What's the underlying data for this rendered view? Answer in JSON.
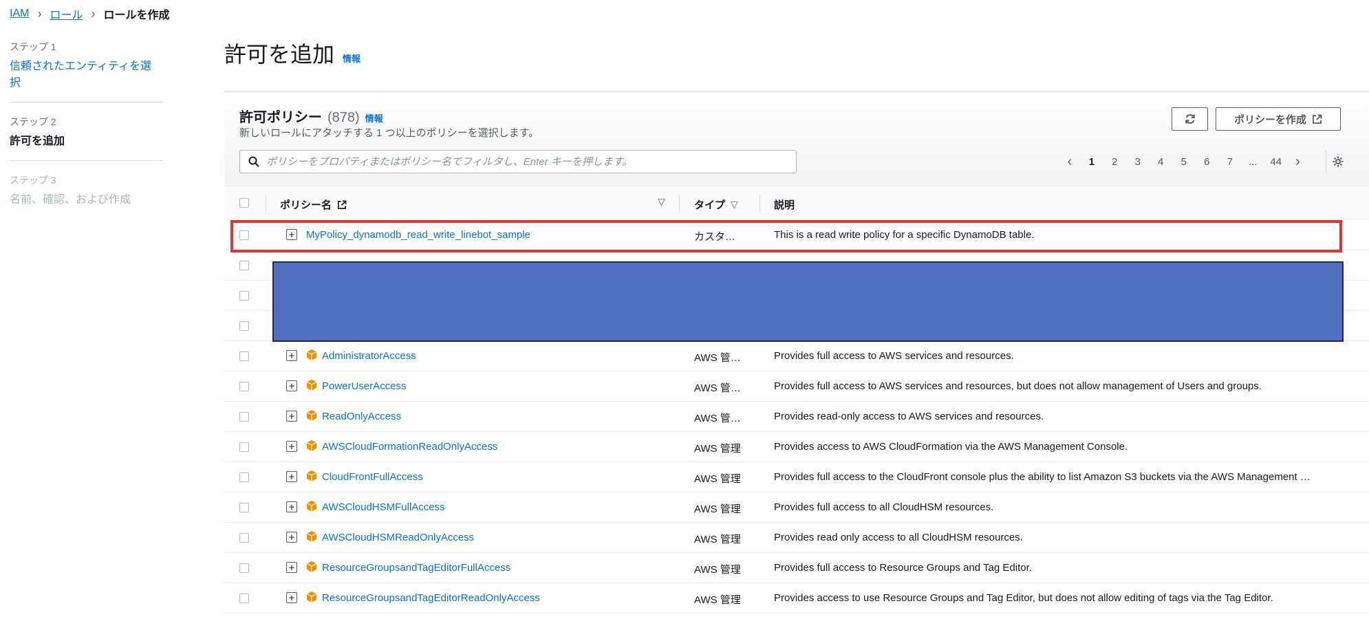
{
  "breadcrumb": {
    "items": [
      "IAM",
      "ロール"
    ],
    "current": "ロールを作成"
  },
  "steps": [
    {
      "label": "ステップ 1",
      "title": "信頼されたエンティティを選択",
      "state": "link"
    },
    {
      "label": "ステップ 2",
      "title": "許可を追加",
      "state": "active"
    },
    {
      "label": "ステップ 3",
      "title": "名前、確認、および作成",
      "state": "disabled"
    }
  ],
  "page": {
    "title": "許可を追加",
    "info": "情報"
  },
  "panel": {
    "title": "許可ポリシー",
    "count": "(878)",
    "info": "情報",
    "description": "新しいロールにアタッチする 1 つ以上のポリシーを選択します。",
    "create_button": "ポリシーを作成",
    "refresh_icon": "refresh-icon",
    "search_placeholder": "ポリシーをプロパティまたはポリシー名でフィルタし、Enter キーを押します。"
  },
  "pagination": {
    "pages": [
      "1",
      "2",
      "3",
      "4",
      "5",
      "6",
      "7",
      "...",
      "44"
    ],
    "current": "1"
  },
  "table": {
    "columns": {
      "name": "ポリシー名",
      "type": "タイプ",
      "description": "説明"
    },
    "rows": [
      {
        "name": "MyPolicy_dynamodb_read_write_linebot_sample",
        "type": "カスタ…",
        "description": "This is a read write policy for a specific DynamoDB table.",
        "aws_managed": false
      },
      {
        "name": "",
        "type": "",
        "description": "",
        "redacted": true
      },
      {
        "name": "",
        "type": "",
        "description": "",
        "redacted": true
      },
      {
        "name": "",
        "type": "",
        "description": "",
        "redacted": true
      },
      {
        "name": "AdministratorAccess",
        "type": "AWS 管…",
        "description": "Provides full access to AWS services and resources.",
        "aws_managed": true
      },
      {
        "name": "PowerUserAccess",
        "type": "AWS 管…",
        "description": "Provides full access to AWS services and resources, but does not allow management of Users and groups.",
        "aws_managed": true
      },
      {
        "name": "ReadOnlyAccess",
        "type": "AWS 管…",
        "description": "Provides read-only access to AWS services and resources.",
        "aws_managed": true
      },
      {
        "name": "AWSCloudFormationReadOnlyAccess",
        "type": "AWS 管理",
        "description": "Provides access to AWS CloudFormation via the AWS Management Console.",
        "aws_managed": true
      },
      {
        "name": "CloudFrontFullAccess",
        "type": "AWS 管理",
        "description": "Provides full access to the CloudFront console plus the ability to list Amazon S3 buckets via the AWS Management …",
        "aws_managed": true
      },
      {
        "name": "AWSCloudHSMFullAccess",
        "type": "AWS 管理",
        "description": "Provides full access to all CloudHSM resources.",
        "aws_managed": true
      },
      {
        "name": "AWSCloudHSMReadOnlyAccess",
        "type": "AWS 管理",
        "description": "Provides read only access to all CloudHSM resources.",
        "aws_managed": true
      },
      {
        "name": "ResourceGroupsandTagEditorFullAccess",
        "type": "AWS 管理",
        "description": "Provides full access to Resource Groups and Tag Editor.",
        "aws_managed": true
      },
      {
        "name": "ResourceGroupsandTagEditorReadOnlyAccess",
        "type": "AWS 管理",
        "description": "Provides access to use Resource Groups and Tag Editor, but does not allow editing of tags via the Tag Editor.",
        "aws_managed": true
      }
    ]
  },
  "colors": {
    "link": "#0972d3",
    "highlight": "#e5322c",
    "redaction": "#5171c1",
    "aws_package": "#f29100"
  }
}
